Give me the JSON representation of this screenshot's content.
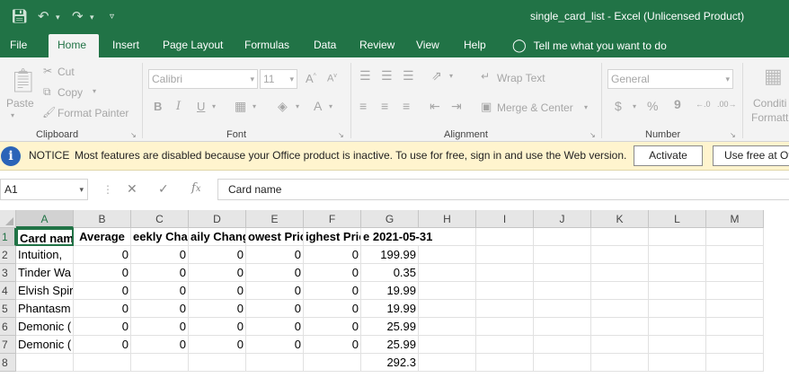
{
  "window": {
    "title": "single_card_list  -  Excel (Unlicensed Product)",
    "qa_icons": [
      "save-icon",
      "undo-icon",
      "redo-icon",
      "customize-icon"
    ]
  },
  "tabs": [
    {
      "label": "File"
    },
    {
      "label": "Home"
    },
    {
      "label": "Insert"
    },
    {
      "label": "Page Layout"
    },
    {
      "label": "Formulas"
    },
    {
      "label": "Data"
    },
    {
      "label": "Review"
    },
    {
      "label": "View"
    },
    {
      "label": "Help"
    }
  ],
  "tell_me": "Tell me what you want to do",
  "ribbon": {
    "clipboard": {
      "paste": "Paste",
      "cut": "Cut",
      "copy": "Copy",
      "format_painter": "Format Painter",
      "label": "Clipboard"
    },
    "font": {
      "name": "Calibri",
      "size": "11",
      "bold": "B",
      "italic": "I",
      "underline": "U",
      "label": "Font"
    },
    "alignment": {
      "wrap": "Wrap Text",
      "merge": "Merge & Center",
      "label": "Alignment"
    },
    "number": {
      "format": "General",
      "currency": "$",
      "percent": "%",
      "comma": "9",
      "label": "Number"
    },
    "styles": {
      "conditional": "Conditi",
      "formatting": "Formatti"
    }
  },
  "notice": {
    "label": "NOTICE",
    "message": "Most features are disabled because your Office product is inactive. To use for free, sign in and use the Web version.",
    "activate": "Activate",
    "use_free": "Use free at Of"
  },
  "formula_bar": {
    "name_box": "A1",
    "content": "Card name"
  },
  "grid": {
    "columns": [
      "A",
      "B",
      "C",
      "D",
      "E",
      "F",
      "G",
      "H",
      "I",
      "J",
      "K",
      "L",
      "M"
    ],
    "rows": [
      "1",
      "2",
      "3",
      "4",
      "5",
      "6",
      "7",
      "8"
    ],
    "headers": [
      "Card name",
      "Average",
      "eekly Chan",
      "aily Chang",
      "owest Pric",
      "ighest Pric",
      "e 2021-05-31"
    ],
    "data": [
      [
        "Intuition,",
        "0",
        "0",
        "0",
        "0",
        "0",
        "199.99"
      ],
      [
        "Tinder Wa",
        "0",
        "0",
        "0",
        "0",
        "0",
        "0.35"
      ],
      [
        "Elvish Spir",
        "0",
        "0",
        "0",
        "0",
        "0",
        "19.99"
      ],
      [
        "Phantasm",
        "0",
        "0",
        "0",
        "0",
        "0",
        "19.99"
      ],
      [
        "Demonic (",
        "0",
        "0",
        "0",
        "0",
        "0",
        "25.99"
      ],
      [
        "Demonic (",
        "0",
        "0",
        "0",
        "0",
        "0",
        "25.99"
      ],
      [
        "",
        "",
        "",
        "",
        "",
        "",
        "292.3"
      ]
    ]
  }
}
